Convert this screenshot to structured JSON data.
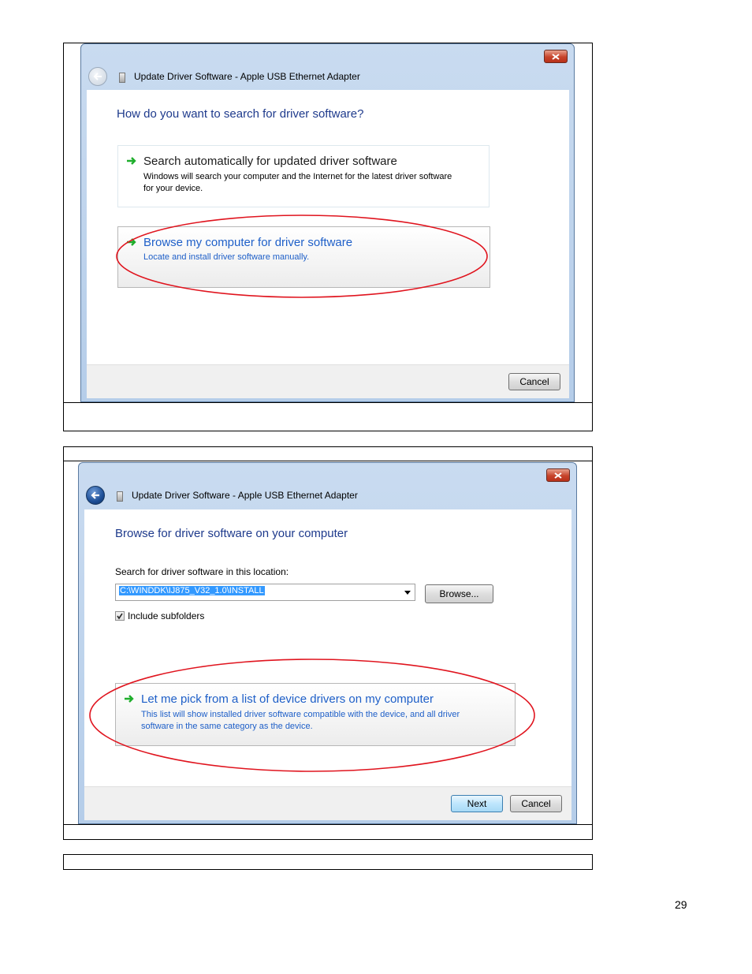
{
  "screenshot1": {
    "title": "Update Driver Software - Apple USB Ethernet Adapter",
    "heading": "How do you want to search for driver software?",
    "option1": {
      "title": "Search automatically for updated driver software",
      "desc_line1": "Windows will search your computer and the Internet for the latest driver software",
      "desc_line2": "for your device."
    },
    "option2": {
      "title": "Browse my computer for driver software",
      "desc": "Locate and install driver software manually."
    },
    "cancel_label": "Cancel"
  },
  "screenshot2": {
    "title": "Update Driver Software - Apple USB Ethernet Adapter",
    "heading": "Browse for driver software on your computer",
    "location_label": "Search for driver software in this location:",
    "path_value": "C:\\WINDDK\\IJ875_V32_1.0\\INSTALL",
    "browse_label": "Browse...",
    "include_subfolders_label": "Include subfolders",
    "include_subfolders_checked": true,
    "option": {
      "title": "Let me pick from a list of device drivers on my computer",
      "desc_line1": "This list will show installed driver software compatible with the device, and all driver",
      "desc_line2": "software in the same category as the device."
    },
    "next_label": "Next",
    "cancel_label": "Cancel"
  },
  "colors": {
    "highlight_ellipse": "#e0141e",
    "heading_blue": "#1e3a8c",
    "link_blue": "#1e5fc8",
    "arrow_green": "#1fae2c"
  },
  "page_number": "29"
}
